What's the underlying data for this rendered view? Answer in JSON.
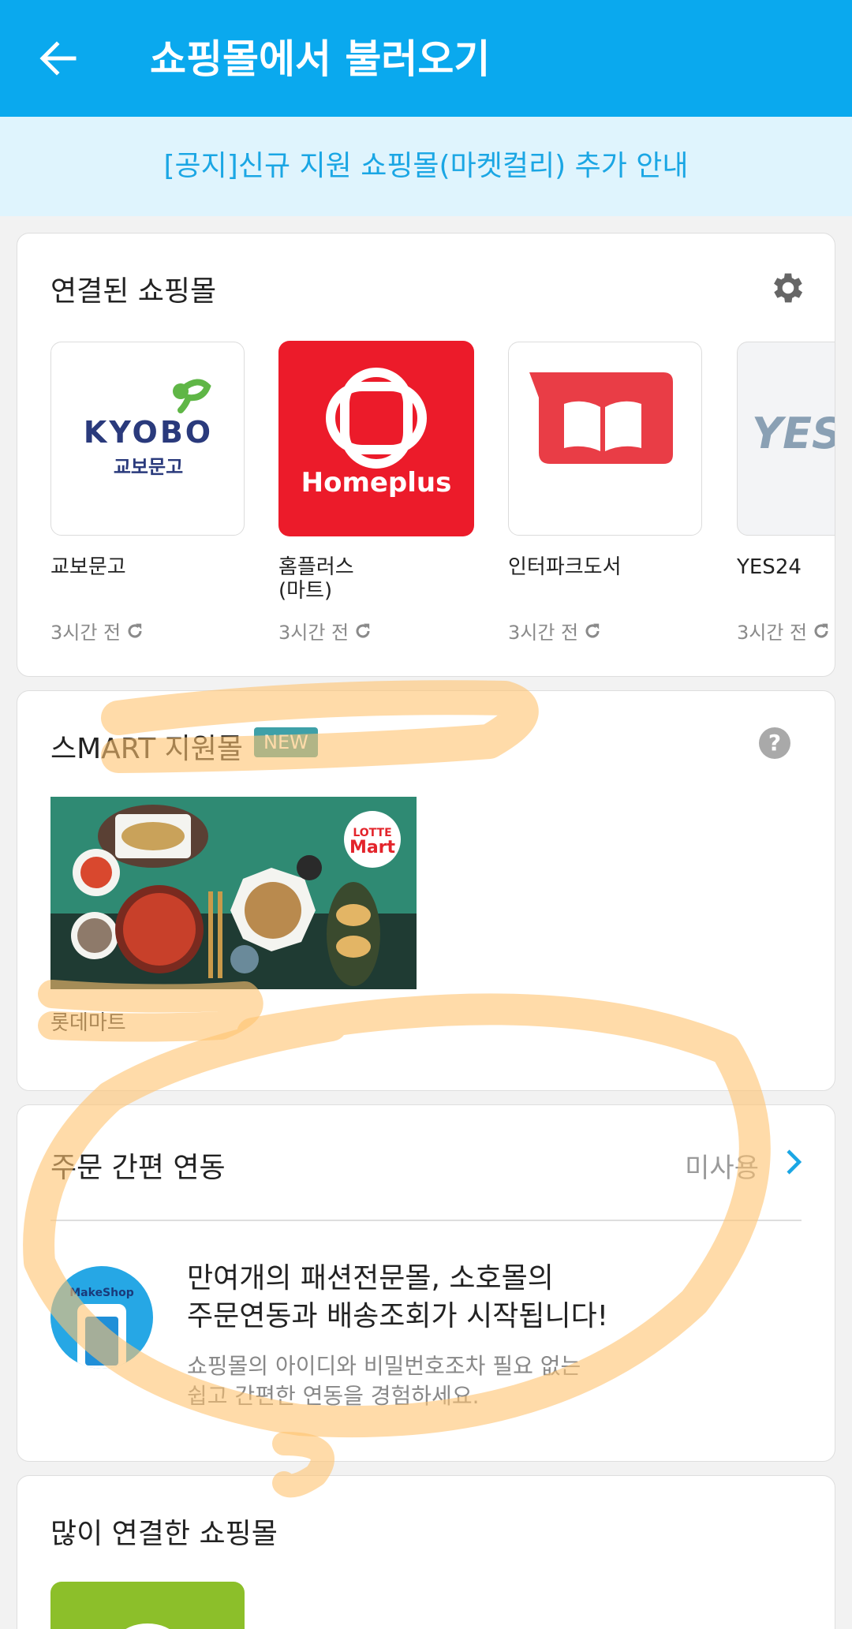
{
  "appbar": {
    "title": "쇼핑몰에서 불러오기"
  },
  "notice": {
    "text": "[공지]신규 지원 쇼핑몰(마켓컬리) 추가 안내"
  },
  "connected": {
    "title": "연결된 쇼핑몰",
    "malls": [
      {
        "name": "교보문고",
        "time": "3시간 전",
        "logo_main": "KYOBO",
        "logo_sub": "교보문고"
      },
      {
        "name": "홈플러스\n(마트)",
        "time": "3시간 전",
        "logo_main": "Homeplus"
      },
      {
        "name": "인터파크도서",
        "time": "3시간 전"
      },
      {
        "name": "YES24",
        "time": "3시간 전",
        "logo_main": "YES"
      }
    ]
  },
  "smart": {
    "title": "스MART 지원몰",
    "badge": "NEW",
    "help": "?",
    "mall_label": "롯데마트",
    "banner_logo_1": "LOTTE",
    "banner_logo_2": "Mart"
  },
  "order": {
    "title": "주문 간편 연동",
    "status": "미사용",
    "logo_text": "MakeShop",
    "headline_1": "만여개의 패션전문몰, 소호몰의",
    "headline_2": "주문연동과 배송조회가 시작됩니다!",
    "sub_1": "쇼핑몰의 아이디와 비밀번호조차 필요 없는",
    "sub_2": "쉽고 간편한 연동을 경험하세요."
  },
  "popular": {
    "title": "많이 연결한 쇼핑몰"
  },
  "colors": {
    "appbar": "#0aa9ee",
    "notice_bg": "#dff4fd",
    "notice_text": "#1aa6e4",
    "badge": "#3ea0a8",
    "highlighter": "#ffc370"
  }
}
